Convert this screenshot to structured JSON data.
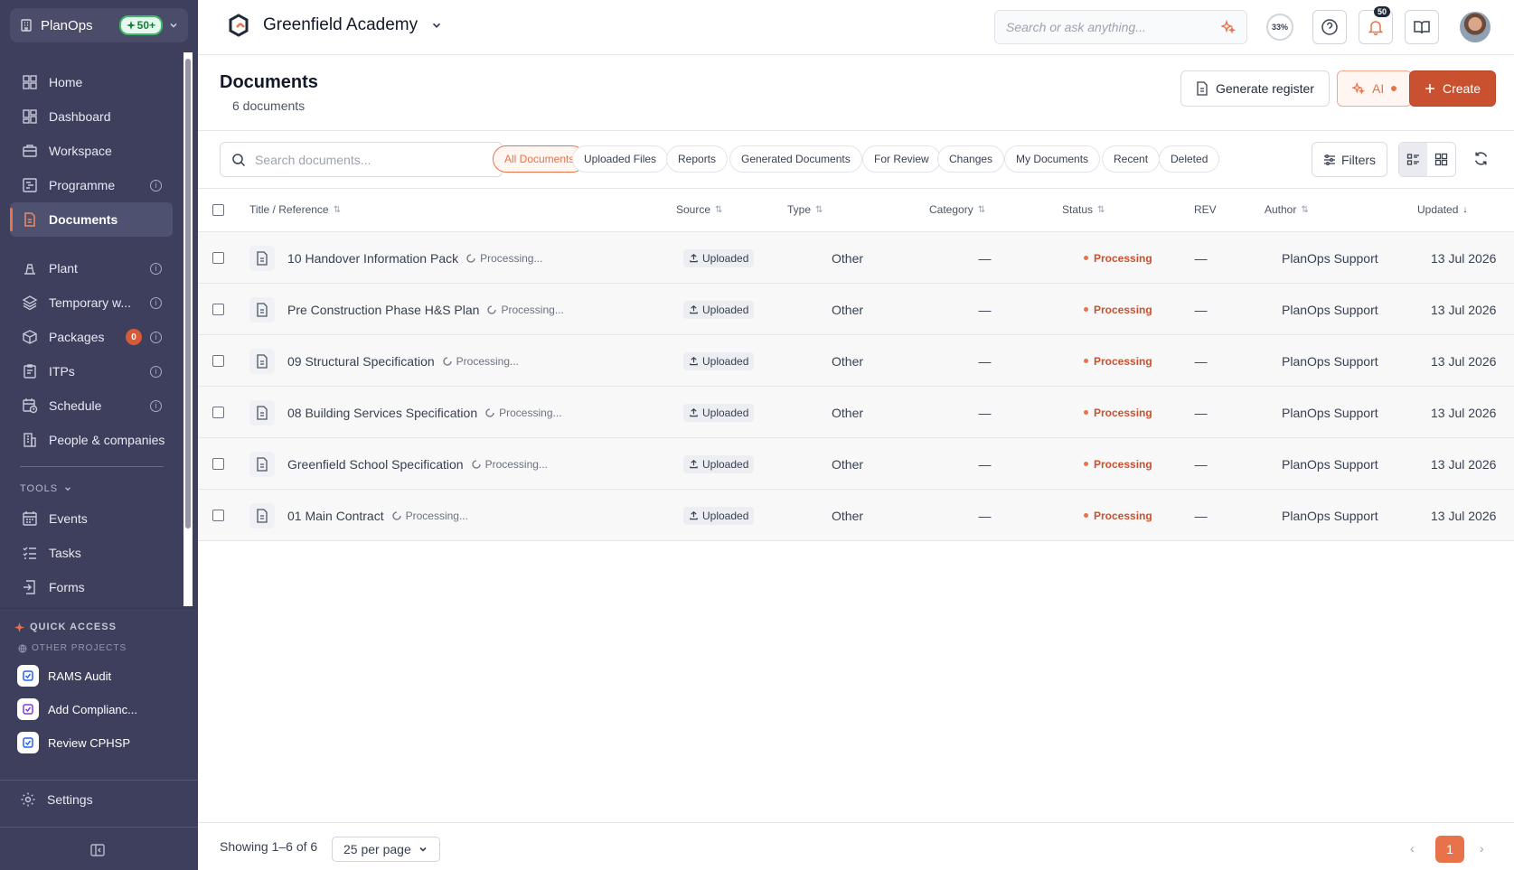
{
  "sidebar": {
    "org_name": "PlanOps",
    "org_badge": "50+",
    "nav": [
      {
        "label": "Home",
        "icon": "grid-icon"
      },
      {
        "label": "Dashboard",
        "icon": "dashboard-icon"
      },
      {
        "label": "Workspace",
        "icon": "briefcase-icon"
      },
      {
        "label": "Programme",
        "icon": "gantt-icon",
        "info": true
      },
      {
        "label": "Documents",
        "icon": "document-icon",
        "active": true
      },
      {
        "label": "Plant",
        "icon": "plant-icon",
        "info": true
      },
      {
        "label": "Temporary w...",
        "icon": "layers-icon",
        "info": true
      },
      {
        "label": "Packages",
        "icon": "package-icon",
        "info": true,
        "count": "0"
      },
      {
        "label": "ITPs",
        "icon": "clipboard-icon",
        "info": true
      },
      {
        "label": "Schedule",
        "icon": "calendar-clock-icon",
        "info": true
      },
      {
        "label": "People & companies",
        "icon": "building-icon"
      }
    ],
    "tools_label": "TOOLS",
    "tools": [
      {
        "label": "Events",
        "icon": "calendar-icon"
      },
      {
        "label": "Tasks",
        "icon": "checklist-icon"
      },
      {
        "label": "Forms",
        "icon": "form-icon"
      }
    ],
    "quick_access": {
      "title": "QUICK ACCESS",
      "subtitle": "OTHER PROJECTS",
      "items": [
        {
          "label": "RAMS Audit",
          "color": "#2563eb"
        },
        {
          "label": "Add Complianc...",
          "color": "#7c3aed"
        },
        {
          "label": "Review CPHSP",
          "color": "#2563eb"
        }
      ]
    },
    "settings_label": "Settings"
  },
  "header": {
    "project_name": "Greenfield Academy",
    "search_placeholder": "Search or ask anything...",
    "progress_label": "33%",
    "notification_count": "50"
  },
  "page": {
    "title": "Documents",
    "subtitle": "6 documents",
    "generate_label": "Generate register",
    "ai_label": "AI",
    "create_label": "Create"
  },
  "filters": {
    "search_placeholder": "Search documents...",
    "chips": [
      "All Documents",
      "Uploaded Files",
      "Reports",
      "Generated Documents",
      "For Review",
      "Changes",
      "My Documents",
      "Recent",
      "Deleted"
    ],
    "filters_label": "Filters"
  },
  "table": {
    "headers": {
      "title": "Title / Reference",
      "source": "Source",
      "type": "Type",
      "category": "Category",
      "status": "Status",
      "rev": "REV",
      "author": "Author",
      "updated": "Updated"
    },
    "rows": [
      {
        "title": "10 Handover Information Pack",
        "processing": "Processing...",
        "source": "Uploaded",
        "type": "Other",
        "category": "—",
        "status": "Processing",
        "rev": "—",
        "author": "PlanOps Support",
        "updated": "13 Jul 2026"
      },
      {
        "title": "Pre Construction Phase H&S Plan",
        "processing": "Processing...",
        "source": "Uploaded",
        "type": "Other",
        "category": "—",
        "status": "Processing",
        "rev": "—",
        "author": "PlanOps Support",
        "updated": "13 Jul 2026"
      },
      {
        "title": "09 Structural Specification",
        "processing": "Processing...",
        "source": "Uploaded",
        "type": "Other",
        "category": "—",
        "status": "Processing",
        "rev": "—",
        "author": "PlanOps Support",
        "updated": "13 Jul 2026"
      },
      {
        "title": "08 Building Services Specification",
        "processing": "Processing...",
        "source": "Uploaded",
        "type": "Other",
        "category": "—",
        "status": "Processing",
        "rev": "—",
        "author": "PlanOps Support",
        "updated": "13 Jul 2026"
      },
      {
        "title": "Greenfield School Specification",
        "processing": "Processing...",
        "source": "Uploaded",
        "type": "Other",
        "category": "—",
        "status": "Processing",
        "rev": "—",
        "author": "PlanOps Support",
        "updated": "13 Jul 2026"
      },
      {
        "title": "01 Main Contract",
        "processing": "Processing...",
        "source": "Uploaded",
        "type": "Other",
        "category": "—",
        "status": "Processing",
        "rev": "—",
        "author": "PlanOps Support",
        "updated": "13 Jul 2026"
      }
    ]
  },
  "footer": {
    "showing": "Showing 1–6 of 6",
    "per_page": "25 per page",
    "current_page": "1"
  },
  "colors": {
    "accent": "#e8734a",
    "primary": "#c9512f",
    "sidebar_bg": "#3d3f5c"
  }
}
